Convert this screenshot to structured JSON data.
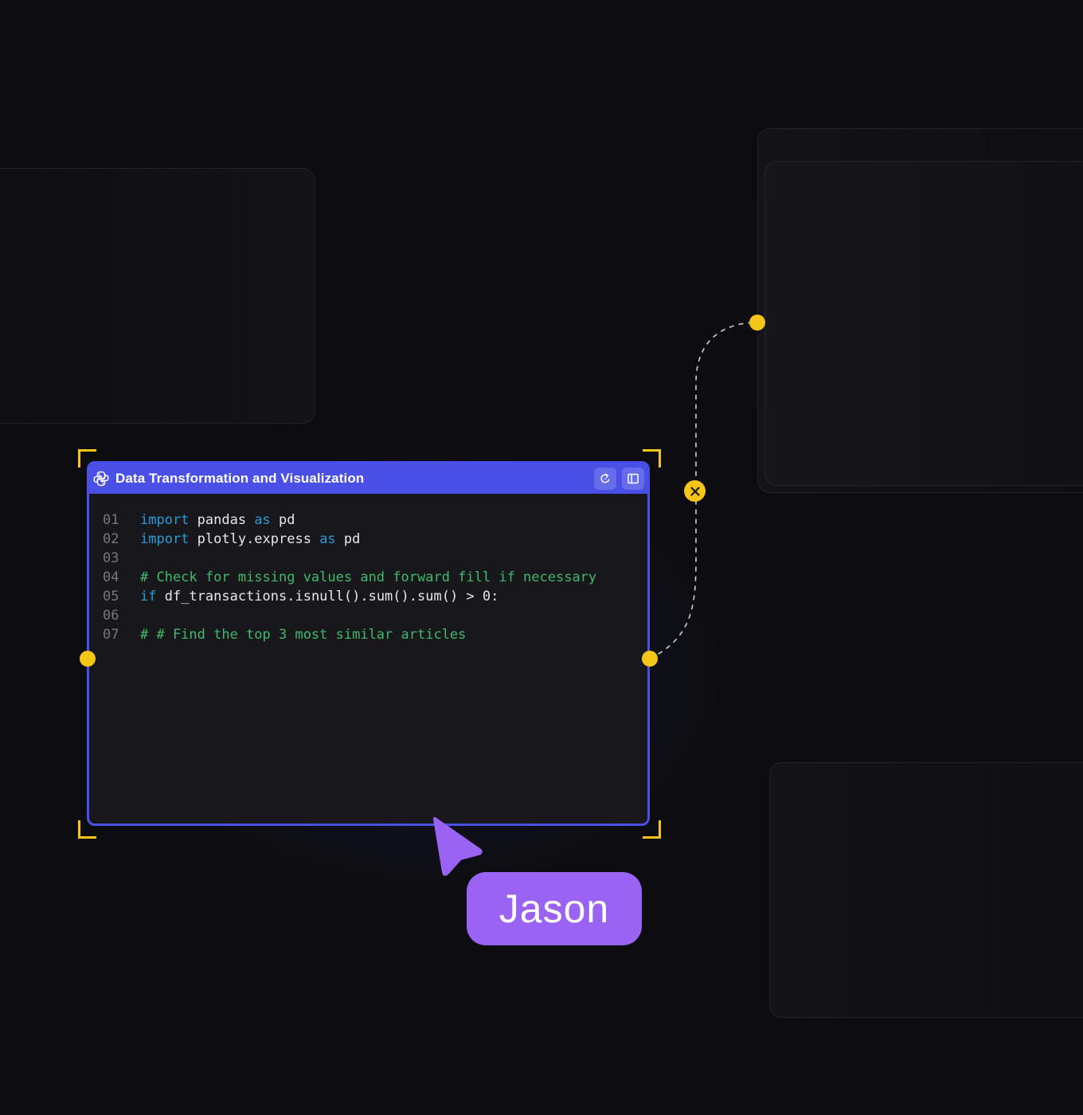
{
  "node": {
    "title": "Data Transformation and Visualization",
    "icon": "python-icon",
    "actions": [
      "refresh-icon",
      "panel-icon"
    ],
    "code_lines": [
      {
        "num": "01",
        "tokens": [
          {
            "t": "import",
            "c": "kw"
          },
          {
            "t": " pandas ",
            "c": "tx"
          },
          {
            "t": "as",
            "c": "kw"
          },
          {
            "t": " pd",
            "c": "tx"
          }
        ]
      },
      {
        "num": "02",
        "tokens": [
          {
            "t": "import",
            "c": "kw"
          },
          {
            "t": " plotly.express ",
            "c": "tx"
          },
          {
            "t": "as",
            "c": "kw"
          },
          {
            "t": " pd",
            "c": "tx"
          }
        ]
      },
      {
        "num": "03",
        "tokens": []
      },
      {
        "num": "04",
        "tokens": [
          {
            "t": "# Check for missing values and forward fill if necessary",
            "c": "cm"
          }
        ]
      },
      {
        "num": "05",
        "tokens": [
          {
            "t": "if",
            "c": "kw"
          },
          {
            "t": " df_transactions.isnull().sum().sum() > 0:",
            "c": "tx"
          }
        ]
      },
      {
        "num": "06",
        "tokens": []
      },
      {
        "num": "07",
        "tokens": [
          {
            "t": "# # Find the top 3 most similar articles",
            "c": "cm"
          }
        ]
      }
    ]
  },
  "collaborator": {
    "name": "Jason",
    "color": "#9b63f4"
  },
  "colors": {
    "background": "#0d0d11",
    "node_accent": "#4a50e6",
    "port": "#f5c518",
    "keyword": "#2b9bd6",
    "comment": "#3fb96b",
    "text": "#e8e8ea",
    "line_number": "#76767e"
  }
}
